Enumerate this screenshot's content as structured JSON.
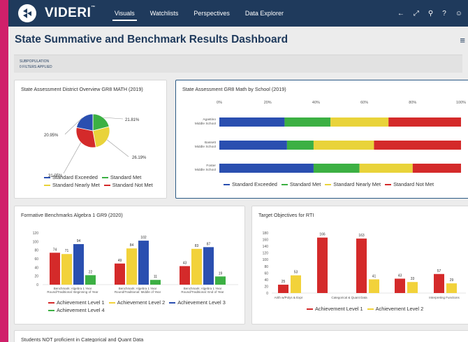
{
  "app": {
    "brand": "VIDERI",
    "trademark": "™",
    "nav": [
      "Visuals",
      "Watchlists",
      "Perspectives",
      "Data Explorer"
    ],
    "active_nav": "Visuals",
    "top_icons": [
      "back-arrow-icon",
      "expand-icon",
      "search-icon",
      "help-icon",
      "user-icon"
    ]
  },
  "page": {
    "title": "State Summative and Benchmark Results Dashboard",
    "subpopulation_label": "SUBPOPULATION",
    "filters_applied": "0 FILTERS APPLIED"
  },
  "colors": {
    "exceeded": "#2a4fb0",
    "met": "#3cb043",
    "nearly_met": "#e9d33a",
    "not_met": "#d42a2a",
    "level1": "#d42a2a",
    "level2": "#f2d23a",
    "level3": "#2a4fb0",
    "level4": "#3cb043"
  },
  "cards": {
    "pie_title": "State Assessment District Overview GR8 MATH (2019)",
    "stacked_title": "State Assessment GR8 Math by School (2019)",
    "formative_title": "Formative Benchmarks Algebra 1 GR9 (2020)",
    "rti_title": "Target Objectives for RTI",
    "bottom_title": "Students NOT proficient in Categorical and Quant Data"
  },
  "chart_data": [
    {
      "type": "pie",
      "title": "State Assessment District Overview GR8 MATH (2019)",
      "labels": [
        "Standard Exceeded",
        "Standard Met",
        "Standard Nearly Met",
        "Standard Not Met"
      ],
      "values": [
        21.81,
        20.95,
        26.19,
        31.05
      ],
      "value_labels": [
        "21.81%",
        "20.95%",
        "26.19%",
        "31.05%"
      ],
      "legend": [
        "Standard Exceeded",
        "Standard Met",
        "Standard Nearly Met",
        "Standard Not Met"
      ]
    },
    {
      "type": "bar",
      "orientation": "horizontal",
      "stacked": true,
      "title": "State Assessment GR8 Math by School (2019)",
      "categories": [
        "Agastino Middle School",
        "Bassett Middle School",
        "Foster Middle School"
      ],
      "x_ticks": [
        "0%",
        "20%",
        "40%",
        "60%",
        "80%",
        "100%"
      ],
      "xlim": [
        0,
        100
      ],
      "series": [
        {
          "name": "Standard Exceeded",
          "values": [
            27,
            28,
            39
          ]
        },
        {
          "name": "Standard Met",
          "values": [
            19,
            11,
            19
          ]
        },
        {
          "name": "Standard Nearly Met",
          "values": [
            24,
            25,
            22
          ]
        },
        {
          "name": "Standard Not Met",
          "values": [
            30,
            36,
            20
          ]
        }
      ]
    },
    {
      "type": "bar",
      "title": "Formative Benchmarks Algebra 1 GR9 (2020)",
      "categories": [
        [
          "Benchmark: Algebra 1 Year",
          "Round/Traditional: Beginning of Year"
        ],
        [
          "Benchmark: Algebra 1 Year",
          "Round/Traditional: Middle of Year"
        ],
        [
          "Benchmark: Algebra 1 Year",
          "Round/Traditional: End of Year"
        ]
      ],
      "y_ticks": [
        "0",
        "20",
        "40",
        "60",
        "80",
        "100",
        "120"
      ],
      "ylim": [
        0,
        120
      ],
      "series": [
        {
          "name": "Achievement Level 1",
          "values": [
            74,
            49,
            43
          ]
        },
        {
          "name": "Achievement Level 2",
          "values": [
            71,
            84,
            83
          ]
        },
        {
          "name": "Achievement Level 3",
          "values": [
            94,
            102,
            87
          ]
        },
        {
          "name": "Achievement Level 4",
          "values": [
            22,
            11,
            19
          ]
        }
      ]
    },
    {
      "type": "bar",
      "title": "Target Objectives for RTI",
      "categories": [
        "Arith w/Polys & Expr",
        "",
        "Categorical & Quant Data",
        "",
        "Interpreting Functions"
      ],
      "y_ticks": [
        "0",
        "20",
        "40",
        "60",
        "80",
        "100",
        "120",
        "140",
        "160",
        "180"
      ],
      "ylim": [
        0,
        180
      ],
      "series": [
        {
          "name": "Achievement Level 1",
          "values": [
            25,
            166,
            163,
            43,
            57
          ]
        },
        {
          "name": "Achievement Level 2",
          "values": [
            53,
            null,
            41,
            33,
            29
          ]
        }
      ]
    }
  ]
}
